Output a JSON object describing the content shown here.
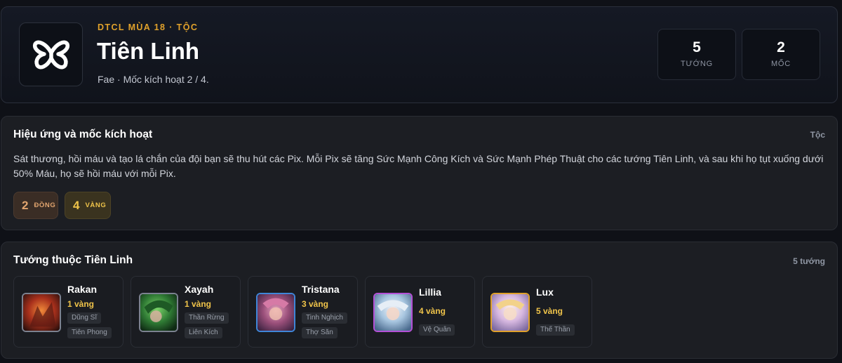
{
  "header": {
    "eyebrow": "DTCL MÙA 18 · TỘC",
    "title": "Tiên Linh",
    "subtitle": "Fae · Mốc kích hoạt 2 / 4.",
    "icon": "fae-butterfly-icon",
    "stats": [
      {
        "value": "5",
        "label": "TƯỚNG"
      },
      {
        "value": "2",
        "label": "MỐC"
      }
    ]
  },
  "effects": {
    "title": "Hiệu ứng và mốc kích hoạt",
    "meta": "Tộc",
    "description": "Sát thương, hồi máu và tạo lá chắn của đội bạn sẽ thu hút các Pix. Mỗi Pix sẽ tăng Sức Mạnh Công Kích và Sức Mạnh Phép Thuật cho các tướng Tiên Linh, và sau khi họ tụt xuống dưới 50% Máu, họ sẽ hồi máu với mỗi Pix.",
    "tiers": [
      {
        "count": "2",
        "label": "ĐỒNG",
        "color": "#e2a56f"
      },
      {
        "count": "4",
        "label": "VÀNG",
        "color": "#f0c44a"
      }
    ]
  },
  "champions": {
    "title": "Tướng thuộc Tiên Linh",
    "meta": "5 tướng",
    "list": [
      {
        "name": "Rakan",
        "cost": "1 vàng",
        "cost_color": "#f0c44a",
        "border": "#7c8290",
        "tags": [
          "Dũng Sĩ",
          "Tiên Phong"
        ]
      },
      {
        "name": "Xayah",
        "cost": "1 vàng",
        "cost_color": "#f0c44a",
        "border": "#7c8290",
        "tags": [
          "Thần Rừng",
          "Liên Kích"
        ]
      },
      {
        "name": "Tristana",
        "cost": "3 vàng",
        "cost_color": "#f0c44a",
        "border": "#3f86d8",
        "tags": [
          "Tinh Nghịch",
          "Thợ Săn"
        ]
      },
      {
        "name": "Lillia",
        "cost": "4 vàng",
        "cost_color": "#f0c44a",
        "border": "#b450d6",
        "tags": [
          "Vệ Quân"
        ]
      },
      {
        "name": "Lux",
        "cost": "5 vàng",
        "cost_color": "#f0c44a",
        "border": "#e0a12b",
        "tags": [
          "Thế Thần"
        ]
      }
    ]
  }
}
